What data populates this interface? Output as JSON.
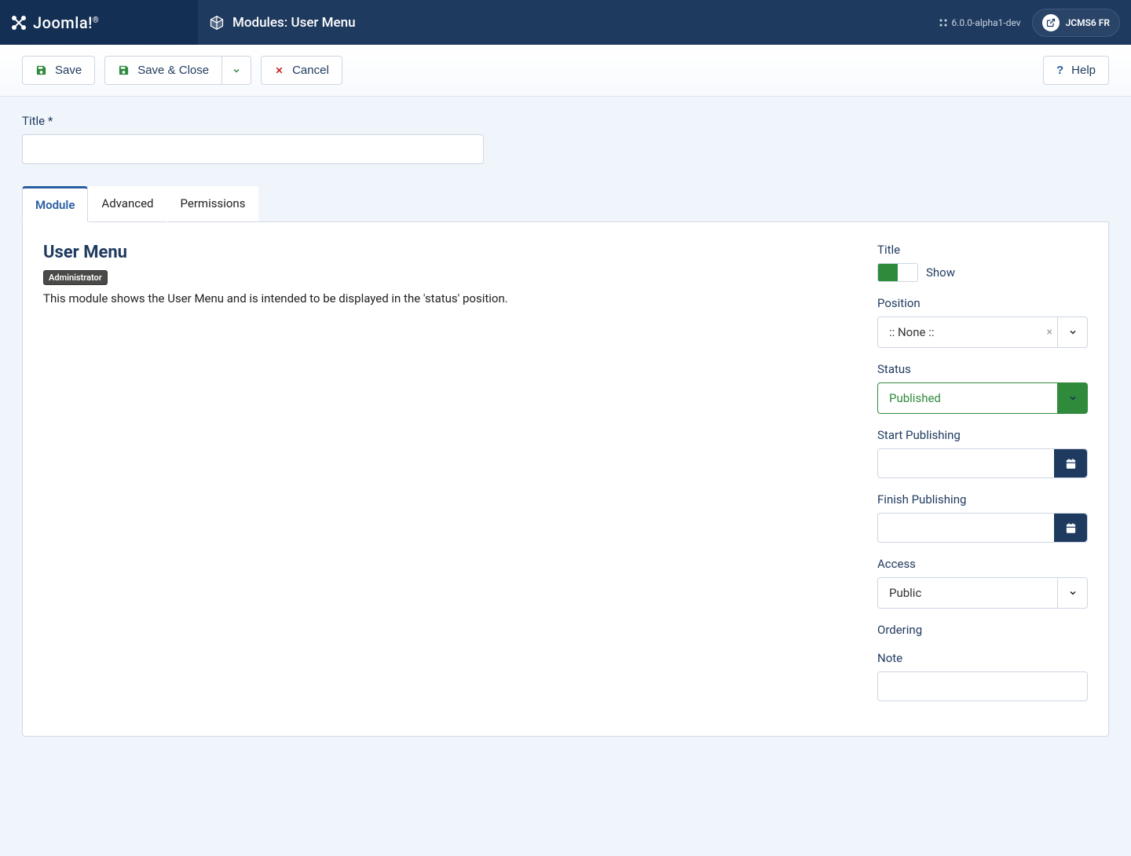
{
  "brand": "Joomla!",
  "page_title": "Modules: User Menu",
  "version": "6.0.0-alpha1-dev",
  "user": "JCMS6 FR",
  "toolbar": {
    "save": "Save",
    "save_close": "Save & Close",
    "cancel": "Cancel",
    "help": "Help"
  },
  "title_label": "Title",
  "title_value": "",
  "tabs": [
    "Module",
    "Advanced",
    "Permissions"
  ],
  "module": {
    "heading": "User Menu",
    "badge": "Administrator",
    "description": "This module shows the User Menu and is intended to be displayed in the 'status' position."
  },
  "side": {
    "title_label": "Title",
    "title_toggle": "Show",
    "position_label": "Position",
    "position_value": ":: None ::",
    "status_label": "Status",
    "status_value": "Published",
    "start_pub_label": "Start Publishing",
    "start_pub_value": "",
    "finish_pub_label": "Finish Publishing",
    "finish_pub_value": "",
    "access_label": "Access",
    "access_value": "Public",
    "ordering_label": "Ordering",
    "note_label": "Note",
    "note_value": ""
  }
}
